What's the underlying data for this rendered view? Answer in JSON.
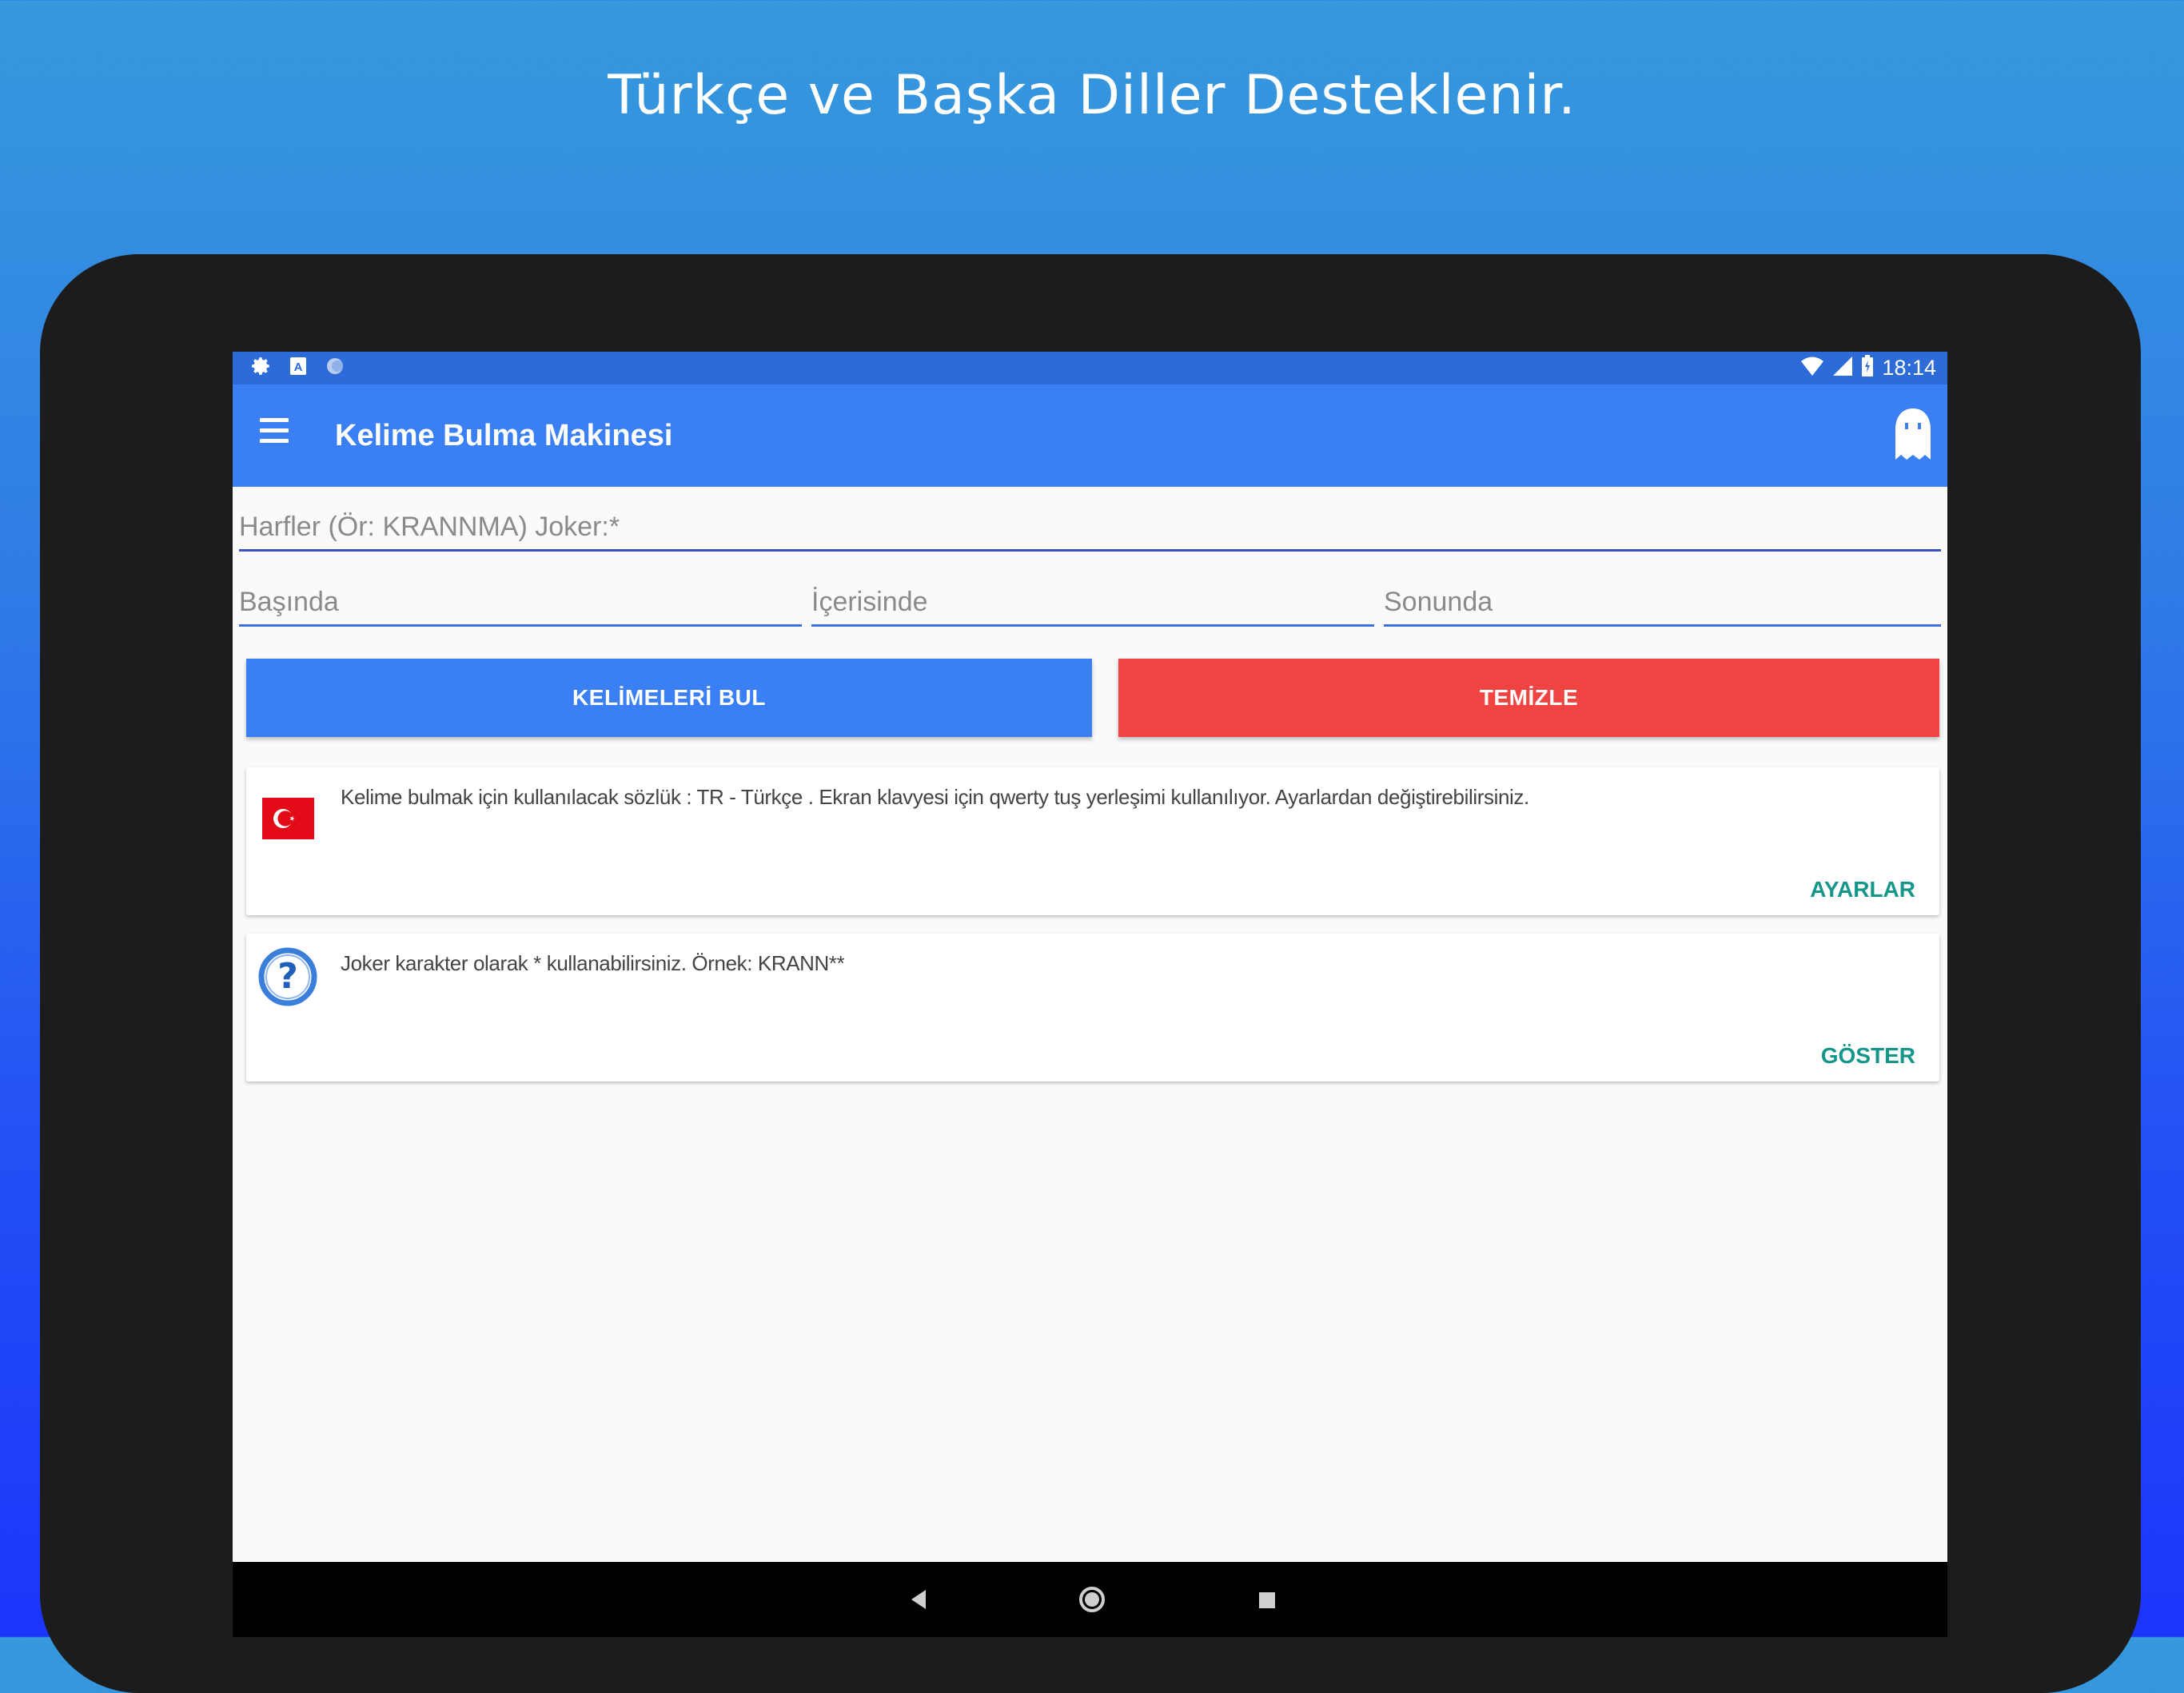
{
  "headline": "Türkçe ve Başka Diller Desteklenir.",
  "status_bar": {
    "time": "18:14",
    "left_icons": [
      "settings-icon",
      "a-badge-icon",
      "circle-icon"
    ],
    "right_icons": [
      "wifi-icon",
      "signal-icon",
      "battery-icon"
    ],
    "badge_letter": "A"
  },
  "toolbar": {
    "title": "Kelime Bulma Makinesi",
    "menu_icon": "hamburger-menu-icon",
    "action_icon": "ghost-icon",
    "color": "#3a7ff3"
  },
  "inputs": {
    "letters": {
      "placeholder": "Harfler (Ör: KRANNMA) Joker:*",
      "value": ""
    },
    "start": {
      "placeholder": "Başında",
      "value": ""
    },
    "inside": {
      "placeholder": "İçerisinde",
      "value": ""
    },
    "end": {
      "placeholder": "Sonunda",
      "value": ""
    }
  },
  "buttons": {
    "find": {
      "label": "KELİMELERİ BUL",
      "color": "#3a7ff3"
    },
    "clear": {
      "label": "TEMİZLE",
      "color": "#f04443"
    }
  },
  "cards": [
    {
      "icon": "turkey-flag-icon",
      "text": "Kelime bulmak için kullanılacak sözlük : TR - Türkçe . Ekran klavyesi için qwerty tuş yerleşimi kullanılıyor. Ayarlardan değiştirebilirsiniz.",
      "action": "AYARLAR"
    },
    {
      "icon": "help-question-icon",
      "text": "Joker karakter olarak * kullanabilirsiniz. Örnek: KRANN**",
      "action": "GÖSTER"
    }
  ],
  "accent_color": "#14968a",
  "nav_bar": {
    "icons": [
      "back-icon",
      "home-icon",
      "recents-icon"
    ]
  }
}
